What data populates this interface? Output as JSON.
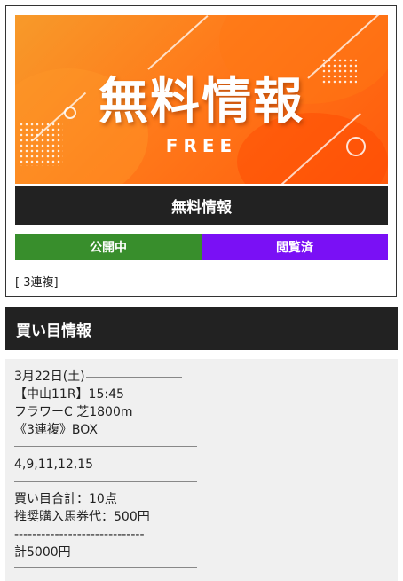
{
  "banner": {
    "title": "無料情報",
    "subtitle": "FREE"
  },
  "card": {
    "title": "無料情報",
    "status_public": "公開中",
    "status_viewed": "閲覧済",
    "tag": "[ 3連複]"
  },
  "colors": {
    "status_public": "#388e2c",
    "status_viewed": "#7a10f5",
    "dark_bar": "#222222",
    "banner_orange": "#ff6a12"
  },
  "section": {
    "heading": "買い目情報"
  },
  "info": {
    "date": "3月22日(土)",
    "race": "【中山11R】15:45",
    "race_name": "フラワーC 芝1800m",
    "bet_type": "《3連複》BOX",
    "numbers": "4,9,11,12,15",
    "total_points": "買い目合計：10点",
    "stake": "推奨購入馬券代：500円",
    "dashes": "-----------------------------",
    "total": "計5000円"
  }
}
